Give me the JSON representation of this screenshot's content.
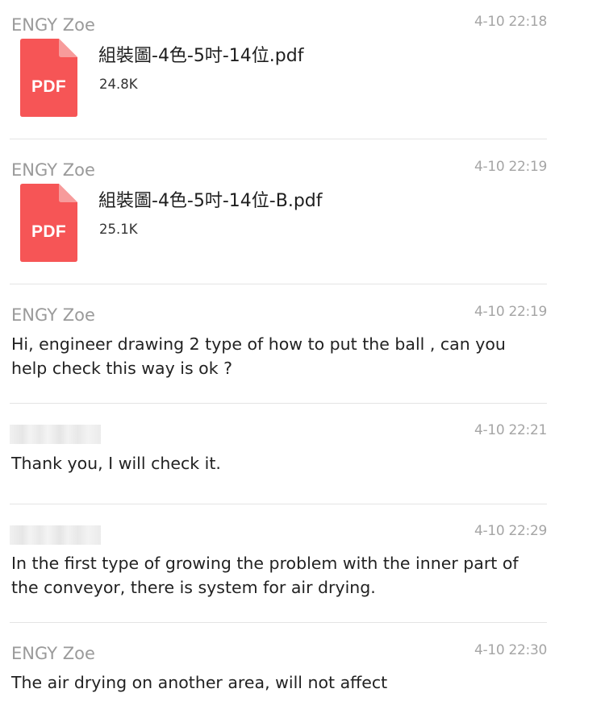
{
  "theme": {
    "pdf_red": "#f65556",
    "pdf_fold": "#f79b9b",
    "sender_gray": "#9a9a9a",
    "divider": "#e4e4e4"
  },
  "messages": [
    {
      "sender": "ENGY Zoe",
      "time": "4-10 22:18",
      "file": {
        "icon": "pdf-icon",
        "icon_label": "PDF",
        "name": "組裝圖-4色-5吋-14位.pdf",
        "size": "24.8K"
      }
    },
    {
      "sender": "ENGY Zoe",
      "time": "4-10 22:19",
      "file": {
        "icon": "pdf-icon",
        "icon_label": "PDF",
        "name": "組裝圖-4色-5吋-14位-B.pdf",
        "size": "25.1K"
      }
    },
    {
      "sender": "ENGY Zoe",
      "time": "4-10 22:19",
      "text": "Hi, engineer drawing 2 type of how to put the ball , can you help check this way is ok ?"
    },
    {
      "sender_redacted": true,
      "time": "4-10 22:21",
      "text": "Thank you, I will check it."
    },
    {
      "sender_redacted": true,
      "time": "4-10 22:29",
      "text": "In the first type of growing the problem with the inner part of the conveyor, there is system for air drying."
    },
    {
      "sender": "ENGY Zoe",
      "time": "4-10 22:30",
      "text": "The air drying on another area, will not affect"
    }
  ]
}
